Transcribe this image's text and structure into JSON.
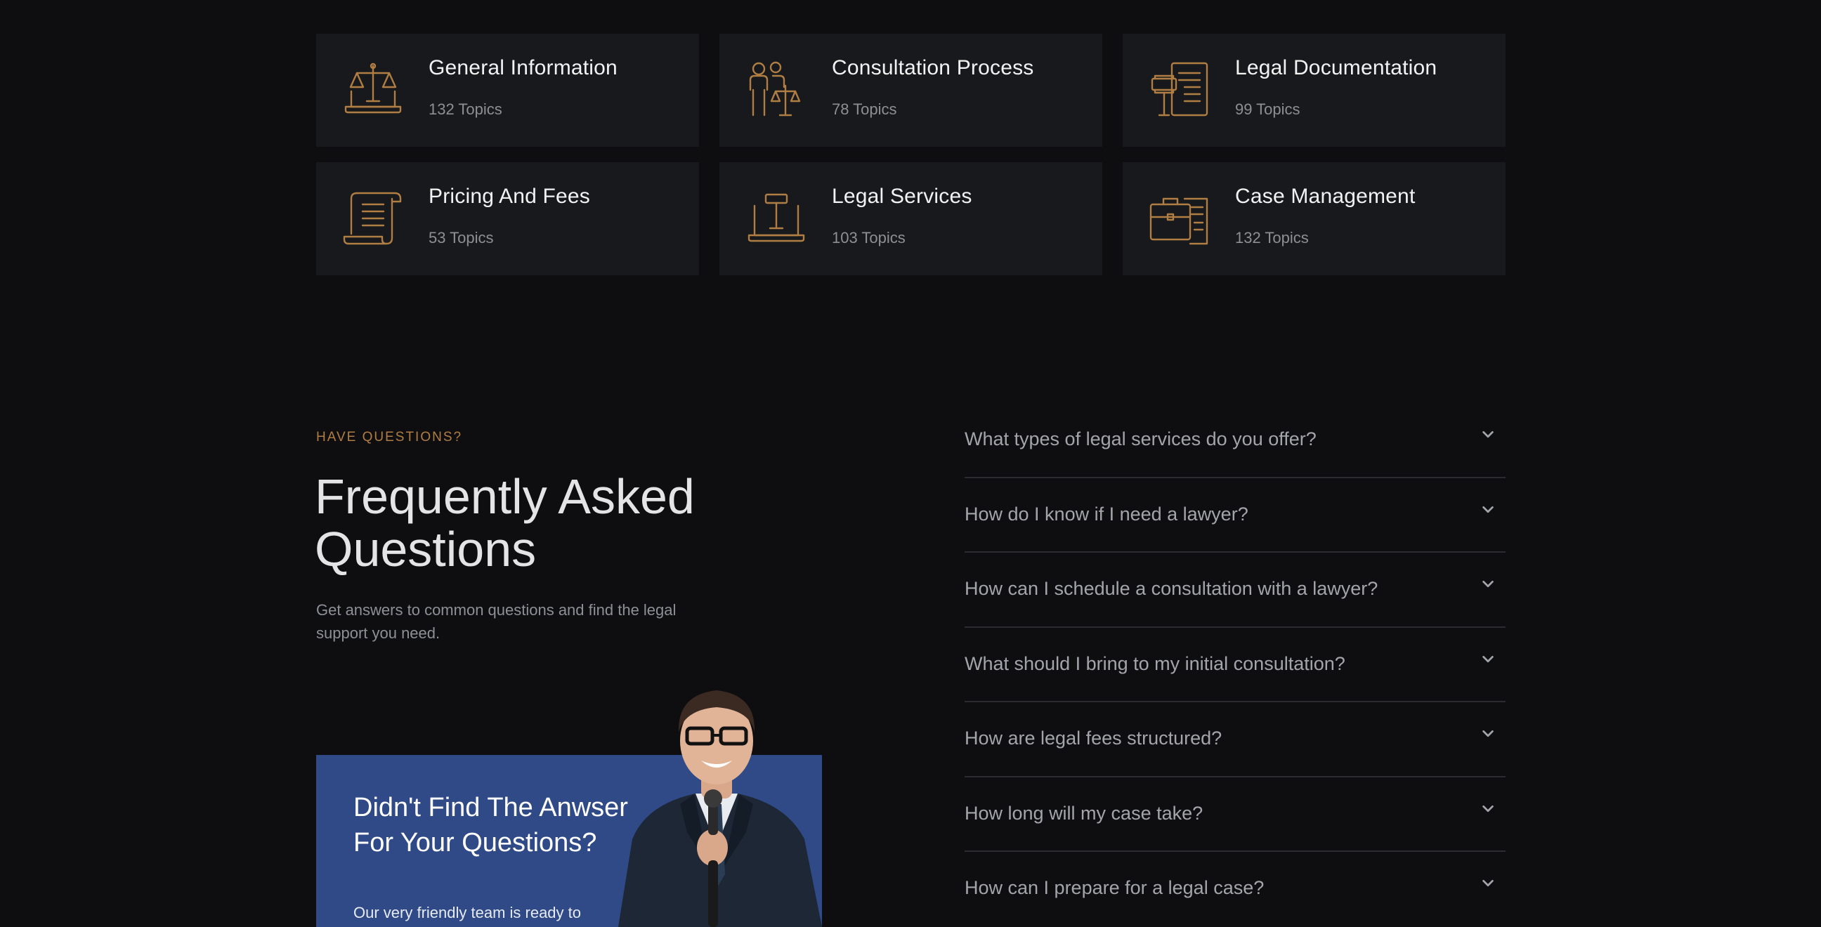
{
  "categories": [
    {
      "title": "General Information",
      "count": "132 Topics",
      "icon": "scales-laptop-icon"
    },
    {
      "title": "Consultation Process",
      "count": "78 Topics",
      "icon": "consultation-people-icon"
    },
    {
      "title": "Legal Documentation",
      "count": "99 Topics",
      "icon": "gavel-document-icon"
    },
    {
      "title": "Pricing And Fees",
      "count": "53 Topics",
      "icon": "scroll-document-icon"
    },
    {
      "title": "Legal Services",
      "count": "103 Topics",
      "icon": "gavel-laptop-icon"
    },
    {
      "title": "Case Management",
      "count": "132 Topics",
      "icon": "briefcase-document-icon"
    }
  ],
  "faq": {
    "eyebrow": "HAVE QUESTIONS?",
    "title": "Frequently Asked Questions",
    "subtitle": "Get answers to common questions and find the legal support you need.",
    "questions": [
      "What types of legal services do you offer?",
      "How do I know if I need a lawyer?",
      "How can I schedule a consultation with a lawyer?",
      "What should I bring to my initial consultation?",
      "How are legal fees structured?",
      "How long will my case take?",
      "How can I prepare for a legal case?"
    ]
  },
  "help_card": {
    "title": "Didn't Find The Anwser For Your Questions?",
    "text": "Our very friendly team is ready to"
  },
  "colors": {
    "accent": "#b07d43",
    "card_bg": "#17191c",
    "page_bg": "#0e0e10",
    "help_bg": "#2f4a86"
  }
}
